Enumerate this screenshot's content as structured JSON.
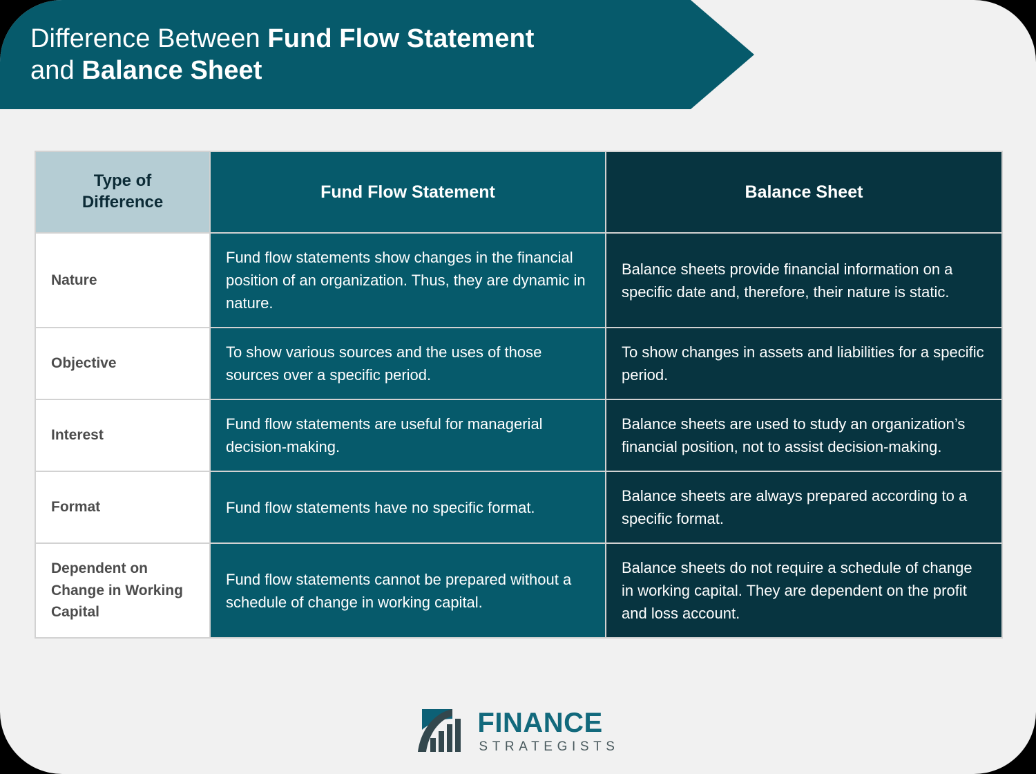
{
  "header": {
    "title_prefix": "Difference Between ",
    "title_bold_1": "Fund Flow Statement",
    "title_middle": " and ",
    "title_bold_2": "Balance Sheet",
    "banner_color": "#065A6B"
  },
  "table": {
    "columns": [
      {
        "label": "Type of Difference",
        "bg": "#b5cdd4"
      },
      {
        "label": "Fund Flow Statement",
        "bg": "#065A6B"
      },
      {
        "label": "Balance Sheet",
        "bg": "#073440"
      }
    ],
    "rows": [
      {
        "label": "Nature",
        "fund_flow": "Fund flow statements show changes in the financial position of an organization. Thus, they are dynamic in nature.",
        "balance_sheet": "Balance sheets provide financial information on a specific date and, therefore, their nature is static."
      },
      {
        "label": "Objective",
        "fund_flow": "To show various sources and the uses of those sources over a specific period.",
        "balance_sheet": "To show changes in assets and liabilities for a specific period."
      },
      {
        "label": "Interest",
        "fund_flow": "Fund flow statements are useful for managerial decision-making.",
        "balance_sheet": "Balance sheets are used to study an organization’s financial position, not to assist decision-making."
      },
      {
        "label": "Format",
        "fund_flow": "Fund flow statements have no specific format.",
        "balance_sheet": "Balance sheets are always prepared according to a specific format."
      },
      {
        "label": "Dependent on Change in Working Capital",
        "fund_flow": "Fund flow statements cannot be prepared without a schedule of change in working capital.",
        "balance_sheet": "Balance sheets do not require a schedule of change in working capital. They are dependent on the profit and loss account."
      }
    ]
  },
  "footer": {
    "logo_primary": "FINANCE",
    "logo_secondary": "STRATEGISTS",
    "logo_primary_color": "#12697C",
    "logo_secondary_color": "#4a5a5e"
  },
  "page": {
    "background": "#f1f1f1"
  }
}
